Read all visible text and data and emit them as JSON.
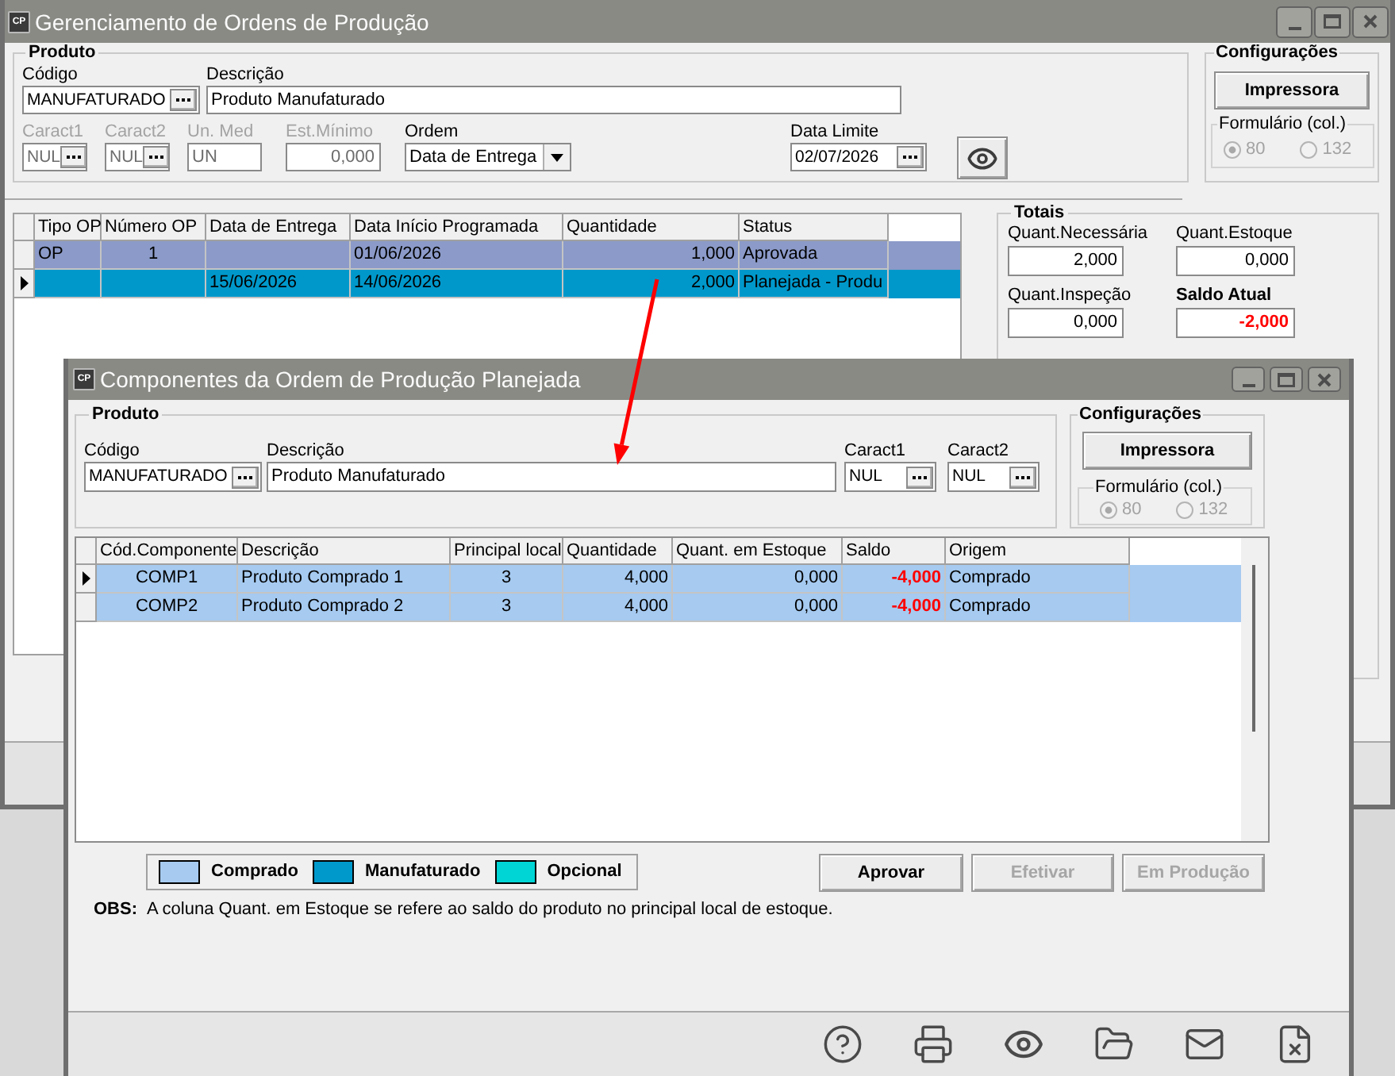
{
  "main_window": {
    "app_icon": "CP",
    "title": "Gerenciamento de Ordens de Produção",
    "produto": {
      "title": "Produto",
      "row_1": [
        {
          "kind": "lookup",
          "label": "Código",
          "value": "MANUFATURADO",
          "disabled": false
        },
        {
          "kind": "text",
          "label": "Descrição",
          "value": "Produto Manufaturado",
          "disabled": false
        }
      ],
      "row_2": [
        {
          "kind": "lookup",
          "label": "Caract1",
          "value": "NUL",
          "disabled": true
        },
        {
          "kind": "lookup",
          "label": "Caract2",
          "value": "NUL",
          "disabled": true
        },
        {
          "kind": "text",
          "label": "Un. Med",
          "value": "UN",
          "disabled": true
        },
        {
          "kind": "number",
          "label": "Est.Mínimo",
          "value": "0,000",
          "disabled": true
        },
        {
          "kind": "select",
          "label": "Ordem",
          "value": "Data de Entrega",
          "disabled": false
        },
        {
          "kind": "lookup",
          "label": "Data Limite",
          "value": "02/07/2026",
          "disabled": false
        }
      ]
    },
    "configuracoes": {
      "title": "Configurações",
      "button": "Impressora",
      "formulario": {
        "title": "Formulário (col.)",
        "disabled": true,
        "options": [
          {
            "label": "80",
            "selected": true
          },
          {
            "label": "132",
            "selected": false
          }
        ]
      }
    },
    "table": {
      "columns": [
        "Tipo OP",
        "Número OP",
        "Data de Entrega",
        "Data Início Programada",
        "Quantidade",
        "Status"
      ],
      "rows": [
        {
          "selected": false,
          "color": "#8b9ac8",
          "cells": [
            "OP",
            "1",
            null,
            "01/06/2026",
            "1,000",
            "Aprovada"
          ]
        },
        {
          "selected": true,
          "color": "#0098cb",
          "cells": [
            null,
            null,
            "15/06/2026",
            "14/06/2026",
            "2,000",
            "Planejada - Produ"
          ]
        }
      ]
    },
    "totais": {
      "title": "Totais",
      "fields": [
        {
          "label": "Quant.Necessária",
          "value": "2,000",
          "alert": false
        },
        {
          "label": "Quant.Estoque",
          "value": "0,000",
          "alert": false
        },
        {
          "label": "Quant.Inspeção",
          "value": "0,000",
          "alert": false
        },
        {
          "label": "Saldo Atual",
          "value": "-2,000",
          "alert": true
        }
      ]
    }
  },
  "child_window": {
    "app_icon": "CP",
    "title": "Componentes da Ordem de Produção Planejada",
    "produto": {
      "title": "Produto",
      "fields": [
        {
          "kind": "lookup",
          "label": "Código",
          "value": "MANUFATURADO"
        },
        {
          "kind": "text",
          "label": "Descrição",
          "value": "Produto Manufaturado"
        },
        {
          "kind": "lookup",
          "label": "Caract1",
          "value": "NUL"
        },
        {
          "kind": "lookup",
          "label": "Caract2",
          "value": "NUL"
        }
      ]
    },
    "configuracoes": {
      "title": "Configurações",
      "button": "Impressora",
      "formulario": {
        "title": "Formulário (col.)",
        "disabled": true,
        "options": [
          {
            "label": "80",
            "selected": true
          },
          {
            "label": "132",
            "selected": false
          }
        ]
      }
    },
    "table": {
      "columns": [
        "Cód.Componente",
        "Descrição",
        "Principal local",
        "Quantidade",
        "Quant. em Estoque",
        "Saldo",
        "Origem"
      ],
      "rows": [
        {
          "selected": true,
          "color": "#a6caf0",
          "cells": [
            "COMP1",
            "Produto Comprado 1",
            "3",
            "4,000",
            "0,000",
            "-4,000",
            "Comprado"
          ]
        },
        {
          "selected": false,
          "color": "#a6caf0",
          "cells": [
            "COMP2",
            "Produto Comprado 2",
            "3",
            "4,000",
            "0,000",
            "-4,000",
            "Comprado"
          ]
        }
      ]
    },
    "legend": [
      {
        "label": "Comprado",
        "color": "#a6caf0"
      },
      {
        "label": "Manufaturado",
        "color": "#0099cc"
      },
      {
        "label": "Opcional",
        "color": "#00d5d5"
      }
    ],
    "buttons": [
      {
        "label": "Aprovar",
        "disabled": false
      },
      {
        "label": "Efetivar",
        "disabled": true
      },
      {
        "label": "Em Produção",
        "disabled": true
      }
    ],
    "note": {
      "label": "OBS:",
      "text": "A coluna Quant. em Estoque se refere ao saldo do produto no principal local de estoque."
    }
  }
}
